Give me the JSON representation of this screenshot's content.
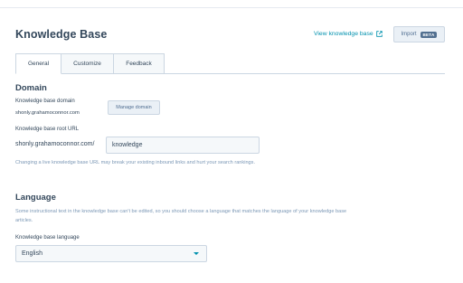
{
  "header": {
    "title": "Knowledge Base",
    "view_link": "View knowledge base",
    "view_link_icon": "external-link-icon",
    "import_label": "Import",
    "beta_badge": "BETA"
  },
  "tabs": [
    {
      "label": "General",
      "active": true
    },
    {
      "label": "Customize",
      "active": false
    },
    {
      "label": "Feedback",
      "active": false
    }
  ],
  "domain": {
    "title": "Domain",
    "domain_label": "Knowledge base domain",
    "domain_value": "shonly.grahamoconnor.com",
    "manage_button": "Manage domain",
    "root_url_label": "Knowledge base root URL",
    "root_url_prefix": "shonly.grahamoconnor.com/",
    "root_url_value": "knowledge",
    "warning": "Changing a live knowledge base URL may break your existing inbound links and hurt your search rankings."
  },
  "language": {
    "title": "Language",
    "description": "Some instructional text in the knowledge base can't be edited, so you should choose a language that matches the language of your knowledge base articles.",
    "field_label": "Knowledge base language",
    "selected": "English"
  },
  "colors": {
    "link": "#0091ae",
    "text": "#33475b",
    "muted": "#7c98b6",
    "border": "#cbd6e2",
    "badge": "#516f90"
  }
}
